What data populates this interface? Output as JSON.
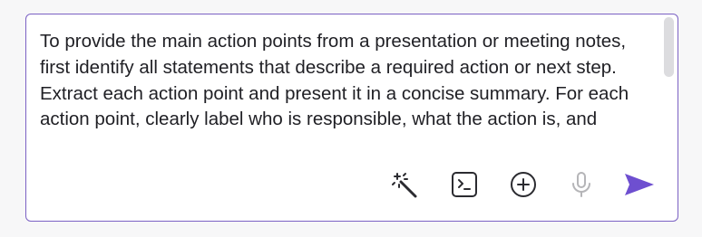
{
  "composer": {
    "prompt_text": "To provide the main action points from a presentation or meeting notes, first identify all statements that describe a required action or next step. Extract each action point and present it in a concise summary. For each action point, clearly label who is responsible, what the action is, and"
  },
  "toolbar": {
    "icons": [
      "magic-wand-icon",
      "terminal-icon",
      "plus-circle-icon",
      "microphone-icon",
      "send-icon"
    ]
  },
  "colors": {
    "accent": "#6e4fd0",
    "border": "#7b61c4",
    "icon": "#2b2b30",
    "icon_disabled": "#b5b5b8"
  }
}
